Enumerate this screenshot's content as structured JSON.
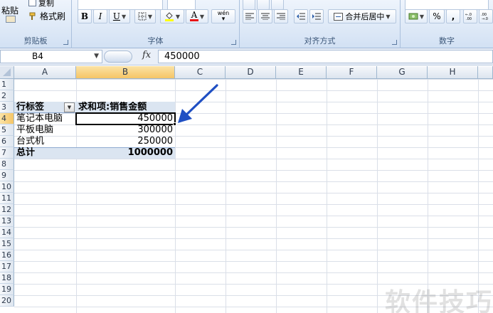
{
  "ribbon": {
    "clipboard": {
      "paste_label": "粘贴",
      "copy_label": "复制",
      "format_painter_label": "格式刷",
      "group_label": "剪贴板"
    },
    "font": {
      "bold": "B",
      "italic": "I",
      "underline": "U",
      "font_color_letter": "A",
      "phonetic": "wén",
      "group_label": "字体",
      "fill_color": "#ffff00",
      "font_color": "#e81416"
    },
    "alignment": {
      "merge_center_label": "合并后居中",
      "group_label": "对齐方式"
    },
    "number": {
      "percent": "%",
      "comma": ",",
      "group_label": "数字"
    }
  },
  "formula_bar": {
    "name_box": "B4",
    "fx": "fx",
    "value": "450000"
  },
  "columns": [
    "A",
    "B",
    "C",
    "D",
    "E",
    "F",
    "G",
    "H"
  ],
  "rows": [
    "1",
    "2",
    "3",
    "4",
    "5",
    "6",
    "7",
    "8",
    "9",
    "10",
    "11",
    "12",
    "13",
    "14",
    "15",
    "16",
    "17",
    "18",
    "19",
    "20"
  ],
  "selected": {
    "column": "B",
    "row": "4"
  },
  "pivot": {
    "row_label_header": "行标签",
    "value_header": "求和项:销售金额",
    "items": [
      {
        "label": "笔记本电脑",
        "value": "450000"
      },
      {
        "label": "平板电脑",
        "value": "300000"
      },
      {
        "label": "台式机",
        "value": "250000"
      }
    ],
    "total_label": "总计",
    "total_value": "1000000"
  },
  "watermark": "软件技巧",
  "colors": {
    "arrow": "#1f4fc3",
    "band": "#dbe5f1",
    "selection_header": "#f5c566"
  }
}
